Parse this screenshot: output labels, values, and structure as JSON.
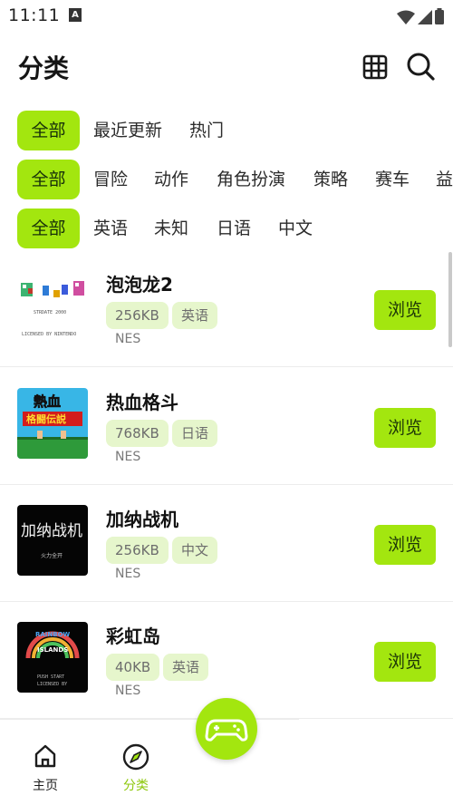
{
  "status_bar": {
    "time": "11:11",
    "a_icon": "A"
  },
  "header": {
    "title": "分类"
  },
  "filters": {
    "sort": [
      "全部",
      "最近更新",
      "热门"
    ],
    "genre": [
      "全部",
      "冒险",
      "动作",
      "角色扮演",
      "策略",
      "赛车",
      "益"
    ],
    "language": [
      "全部",
      "英语",
      "未知",
      "日语",
      "中文"
    ]
  },
  "games": [
    {
      "name": "泡泡龙2",
      "size": "256KB",
      "lang": "英语",
      "platform": "NES",
      "button": "浏览"
    },
    {
      "name": "热血格斗",
      "size": "768KB",
      "lang": "日语",
      "platform": "NES",
      "button": "浏览"
    },
    {
      "name": "加纳战机",
      "size": "256KB",
      "lang": "中文",
      "platform": "NES",
      "button": "浏览"
    },
    {
      "name": "彩虹岛",
      "size": "40KB",
      "lang": "英语",
      "platform": "NES",
      "button": "浏览"
    }
  ],
  "thumbs": {
    "t1_credit": "STRDATE 2000",
    "t1_footer": "LICENSED BY NINTENDO",
    "t2_title": "熱血",
    "t2_subtitle": "格闘伝説",
    "t3_title": "加纳战机",
    "t3_sub": "火力全开",
    "t4_title1": "RAINBOW",
    "t4_title2": "ISLANDS",
    "t4_line1": "PUSH START",
    "t4_line2": "LICENSED BY"
  },
  "nav": {
    "home": "主页",
    "category": "分类"
  },
  "colors": {
    "accent": "#a3e60f",
    "tag_bg": "#e6f6cc",
    "text": "#1b1b1b"
  },
  "icons": {
    "grid": "grid-icon",
    "search": "search-icon",
    "home": "home-icon",
    "compass": "compass-icon",
    "gamepad": "gamepad-icon"
  }
}
